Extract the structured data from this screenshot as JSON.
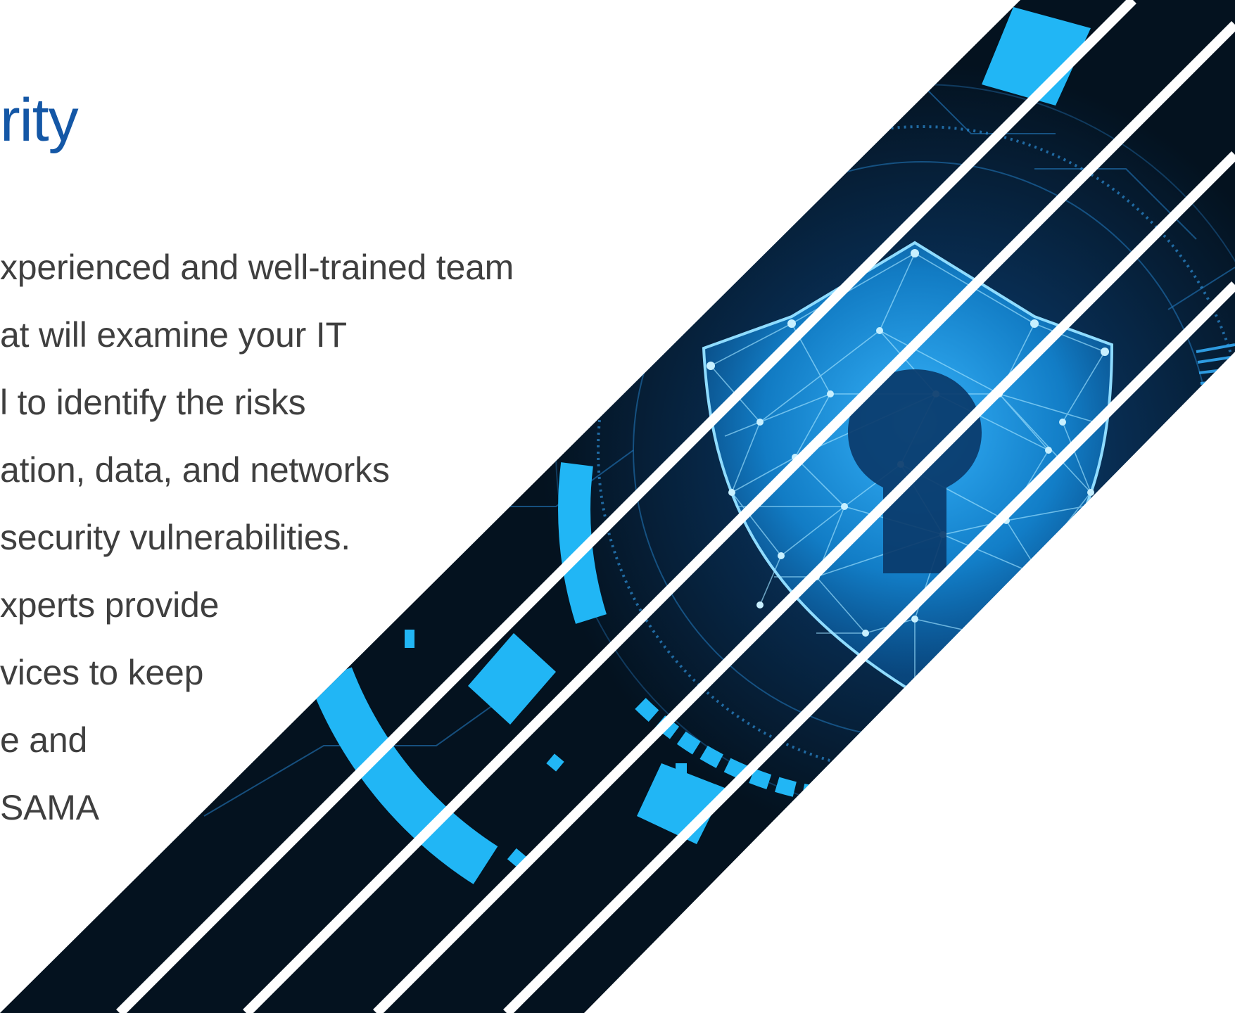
{
  "slide": {
    "title": "rity",
    "title_color": "#1457a6",
    "body_color": "#3f3f3f",
    "body_lines": [
      "xperienced and well-trained team",
      "at will examine your IT",
      "l to identify the risks",
      "ation, data, and networks",
      " security vulnerabilities.",
      "xperts provide",
      "vices to keep",
      "e and",
      "SAMA"
    ]
  },
  "hero_image": {
    "subject": "shield-keyhole",
    "colors": {
      "background": "#04121f",
      "glow": "#1aa2ff",
      "accent": "#21b6f5",
      "mesh": "#7fd4ff",
      "stripe": "#ffffff"
    }
  }
}
